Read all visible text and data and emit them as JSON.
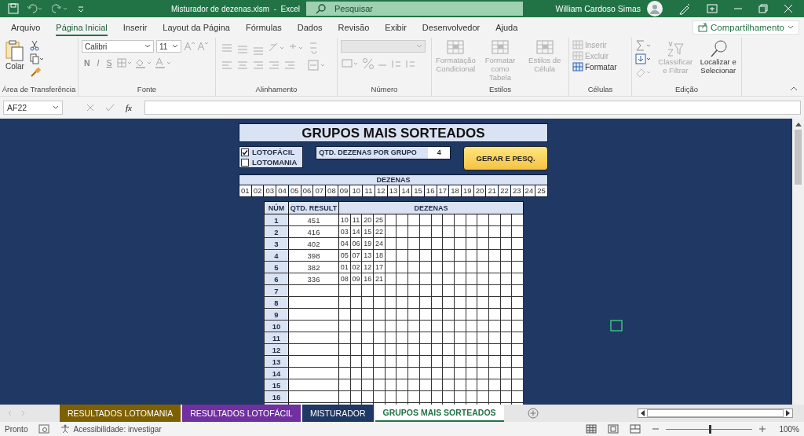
{
  "title_bar": {
    "title": "Misturador de dezenas.xlsm  -  Excel",
    "search": {
      "placeholder": "Pesquisar"
    },
    "user": "William Cardoso Simas"
  },
  "menu_tabs": [
    {
      "label": "Arquivo",
      "selected": false
    },
    {
      "label": "Página Inicial",
      "selected": true
    },
    {
      "label": "Inserir",
      "selected": false
    },
    {
      "label": "Layout da Página",
      "selected": false
    },
    {
      "label": "Fórmulas",
      "selected": false
    },
    {
      "label": "Dados",
      "selected": false
    },
    {
      "label": "Revisão",
      "selected": false
    },
    {
      "label": "Exibir",
      "selected": false
    },
    {
      "label": "Desenvolvedor",
      "selected": false
    },
    {
      "label": "Ajuda",
      "selected": false
    }
  ],
  "share_button": "Compartilhamento",
  "ribbon": [
    {
      "kind": "clipboard",
      "label": "Área de Transferência",
      "paste": "Colar"
    },
    {
      "kind": "font",
      "label": "Fonte",
      "font_name": "Calibri",
      "font_size": "11",
      "styles": [
        "N",
        "I",
        "S"
      ]
    },
    {
      "kind": "alignment",
      "label": "Alinhamento"
    },
    {
      "kind": "number",
      "label": "Número"
    },
    {
      "kind": "styles",
      "label": "Estilos",
      "items": [
        {
          "label": "Formatação Condicional",
          "disabled": true
        },
        {
          "label": "Formatar como Tabela",
          "disabled": true
        },
        {
          "label": "Estilos de Célula",
          "disabled": true
        }
      ]
    },
    {
      "kind": "cells",
      "label": "Células",
      "items": [
        {
          "label": "Inserir",
          "disabled": true
        },
        {
          "label": "Excluir",
          "disabled": true
        },
        {
          "label": "Formatar",
          "disabled": false
        }
      ]
    },
    {
      "kind": "editing",
      "label": "Edição",
      "items": [
        {
          "label": "Classificar e Filtrar",
          "disabled": true
        },
        {
          "label": "Localizar e Selecionar",
          "disabled": false
        }
      ]
    }
  ],
  "formula_bar": {
    "name_box": "AF22",
    "function_label": "fx"
  },
  "sheet": {
    "title": "GRUPOS MAIS SORTEADOS",
    "games": [
      {
        "label": "LOTOFÁCIL",
        "checked": true
      },
      {
        "label": "LOTOMANIA",
        "checked": false
      }
    ],
    "group_size": {
      "label": "QTD. DEZENAS POR GRUPO",
      "value": "4"
    },
    "generate_button": "GERAR E PESQ.",
    "dezenas": {
      "header": "DEZENAS",
      "numbers": [
        "01",
        "02",
        "03",
        "04",
        "05",
        "06",
        "07",
        "08",
        "09",
        "10",
        "11",
        "12",
        "13",
        "14",
        "15",
        "16",
        "17",
        "18",
        "19",
        "20",
        "21",
        "22",
        "23",
        "24",
        "25"
      ]
    },
    "results": {
      "columns": [
        "NÚM",
        "QTD. RESULT",
        "DEZENAS"
      ],
      "rows": [
        {
          "num": "1",
          "qtd": "451",
          "dezenas": [
            "10",
            "11",
            "20",
            "25"
          ]
        },
        {
          "num": "2",
          "qtd": "416",
          "dezenas": [
            "03",
            "14",
            "15",
            "22"
          ]
        },
        {
          "num": "3",
          "qtd": "402",
          "dezenas": [
            "04",
            "06",
            "19",
            "24"
          ]
        },
        {
          "num": "4",
          "qtd": "398",
          "dezenas": [
            "05",
            "07",
            "13",
            "18"
          ]
        },
        {
          "num": "5",
          "qtd": "382",
          "dezenas": [
            "01",
            "02",
            "12",
            "17"
          ]
        },
        {
          "num": "6",
          "qtd": "336",
          "dezenas": [
            "08",
            "09",
            "16",
            "21"
          ]
        },
        {
          "num": "7"
        },
        {
          "num": "8"
        },
        {
          "num": "9"
        },
        {
          "num": "10"
        },
        {
          "num": "11"
        },
        {
          "num": "12"
        },
        {
          "num": "13"
        },
        {
          "num": "14"
        },
        {
          "num": "15"
        },
        {
          "num": "16"
        }
      ]
    }
  },
  "sheet_tabs": [
    {
      "label": "RESULTADOS LOTOMANIA",
      "color": "#7f6000",
      "selected": false
    },
    {
      "label": "RESULTADOS LOTOFÁCIL",
      "color": "#7030a0",
      "selected": false
    },
    {
      "label": "MISTURADOR",
      "color": "#1f3864",
      "selected": false
    },
    {
      "label": "GRUPOS MAIS SORTEADOS",
      "selected": true
    }
  ],
  "status_bar": {
    "status": "Pronto",
    "accessibility": "Acessibilidade: investigar",
    "zoom": {
      "reading": "100%",
      "level": 0.5
    }
  }
}
